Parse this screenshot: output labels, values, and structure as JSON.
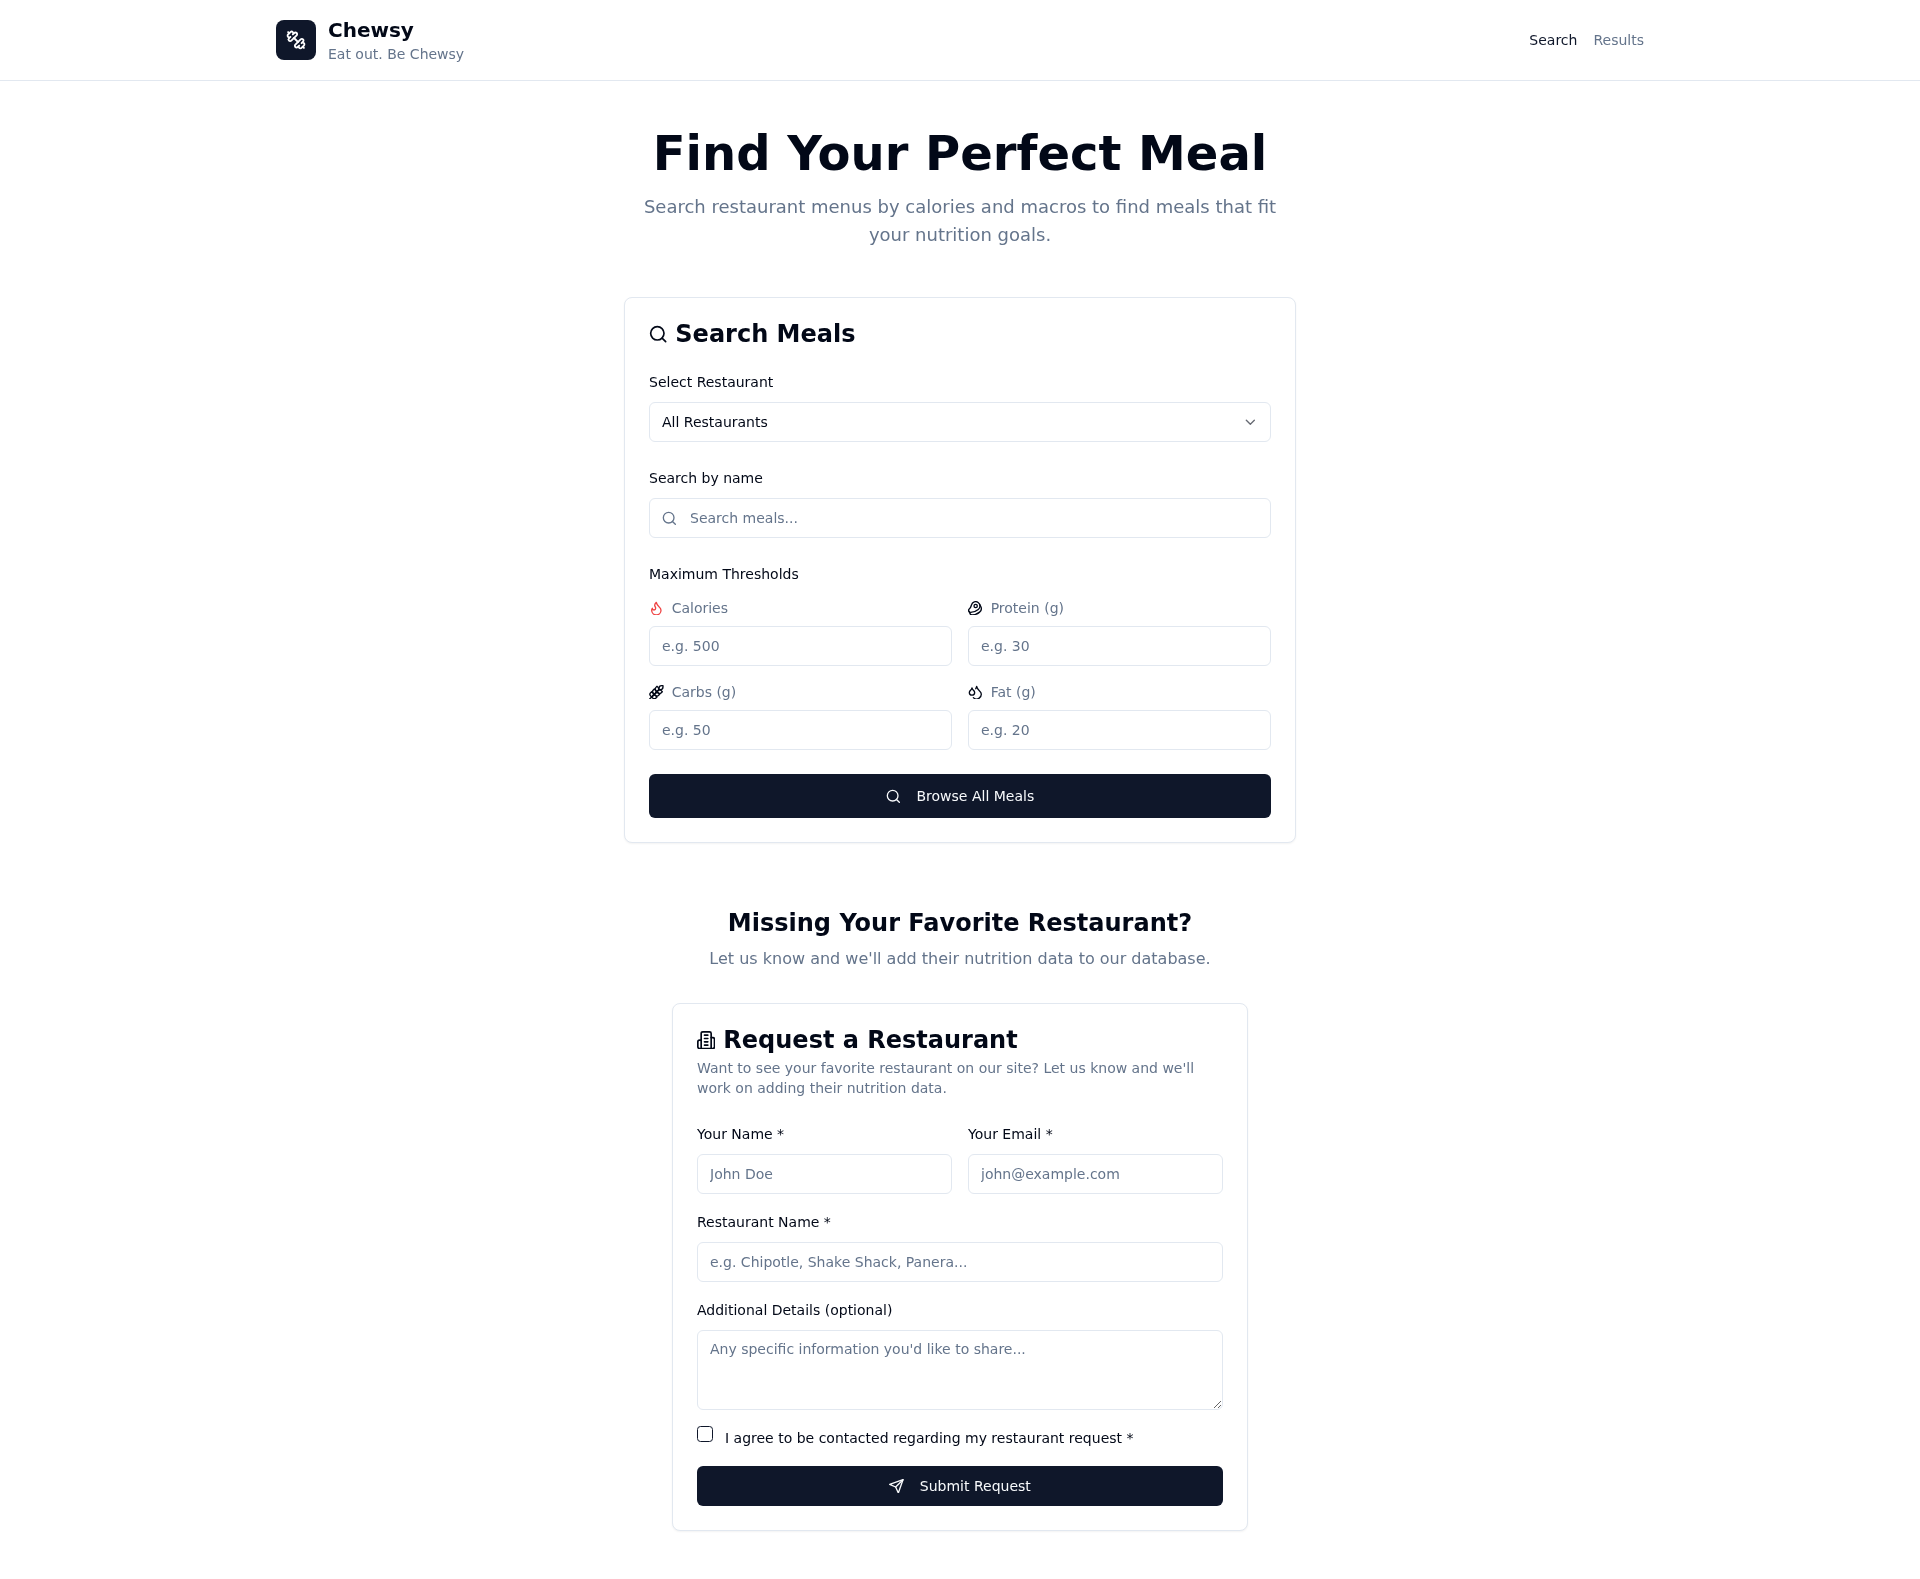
{
  "header": {
    "brand": "Chewsy",
    "tagline": "Eat out. Be Chewsy",
    "nav": [
      {
        "label": "Search",
        "selected": true
      },
      {
        "label": "Results",
        "selected": false
      }
    ]
  },
  "hero": {
    "title": "Find Your Perfect Meal",
    "subtitle": "Search restaurant menus by calories and macros to find meals that fit your nutrition goals."
  },
  "search_card": {
    "title": "Search Meals",
    "restaurant": {
      "label": "Select Restaurant",
      "value": "All Restaurants"
    },
    "name_search": {
      "label": "Search by name",
      "placeholder": "Search meals..."
    },
    "thresholds_label": "Maximum Thresholds",
    "thresholds": [
      {
        "kind": "calories",
        "label": "Calories",
        "placeholder": "e.g. 500"
      },
      {
        "kind": "protein",
        "label": "Protein (g)",
        "placeholder": "e.g. 30"
      },
      {
        "kind": "carbs",
        "label": "Carbs (g)",
        "placeholder": "e.g. 50"
      },
      {
        "kind": "fat",
        "label": "Fat (g)",
        "placeholder": "e.g. 20"
      }
    ],
    "button": "Browse All Meals"
  },
  "request_section": {
    "title": "Missing Your Favorite Restaurant?",
    "subtitle": "Let us know and we'll add their nutrition data to our database."
  },
  "request_card": {
    "title": "Request a Restaurant",
    "description": "Want to see your favorite restaurant on our site? Let us know and we'll work on adding their nutrition data.",
    "rows": [
      {
        "fields": [
          {
            "kind": "input",
            "label": "Your Name *",
            "placeholder": "John Doe"
          },
          {
            "kind": "input",
            "label": "Your Email *",
            "placeholder": "john@example.com"
          }
        ]
      },
      {
        "fields": [
          {
            "kind": "input",
            "label": "Restaurant Name *",
            "placeholder": "e.g. Chipotle, Shake Shack, Panera..."
          }
        ]
      },
      {
        "fields": [
          {
            "kind": "textarea",
            "label": "Additional Details (optional)",
            "placeholder": "Any specific information you'd like to share..."
          }
        ]
      }
    ],
    "consent": {
      "label": "I agree to be contacted regarding my restaurant request *",
      "checked": false
    },
    "button": "Submit Request"
  }
}
